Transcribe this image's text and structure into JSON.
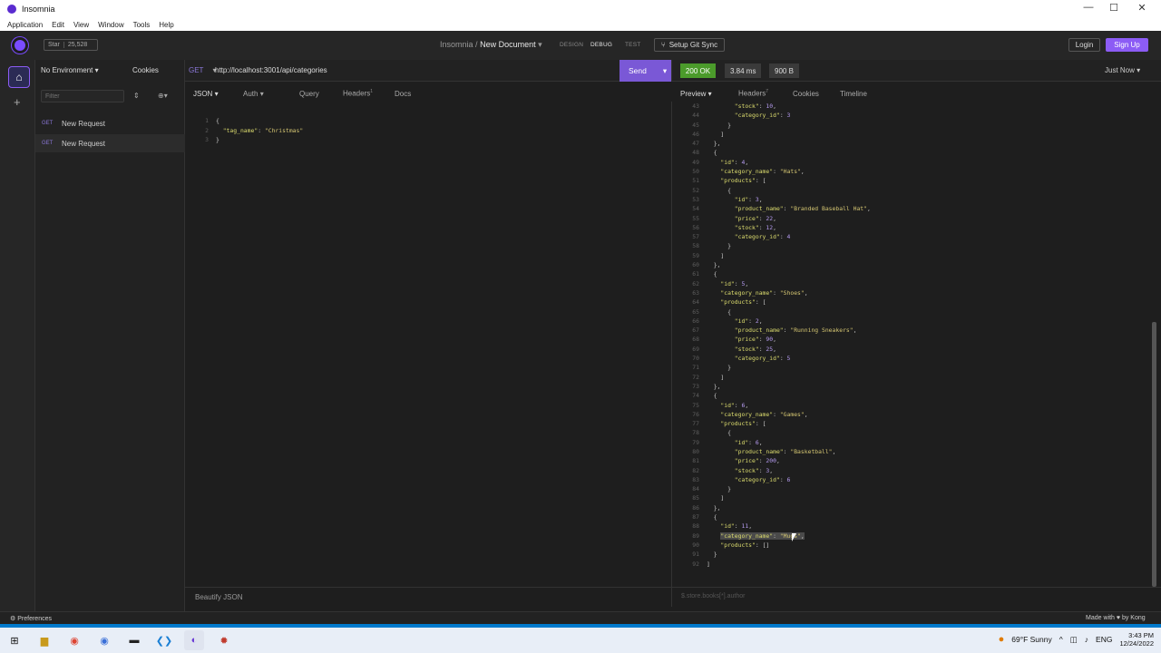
{
  "window": {
    "title": "Insomnia",
    "min": "—",
    "max": "☐",
    "close": "✕"
  },
  "menu": [
    "Application",
    "Edit",
    "View",
    "Window",
    "Tools",
    "Help"
  ],
  "header": {
    "star_label": "Star",
    "star_count": "25,528",
    "workspace": "Insomnia",
    "separator": "/",
    "document": "New Document",
    "modes": [
      "DESIGN",
      "DEBUG",
      "TEST"
    ],
    "git_sync": "Setup Git Sync",
    "login": "Login",
    "signup": "Sign Up"
  },
  "sidebar": {
    "environment": "No Environment",
    "cookies": "Cookies",
    "filter_placeholder": "Filter",
    "requests": [
      {
        "method": "GET",
        "name": "New Request"
      },
      {
        "method": "GET",
        "name": "New Request"
      }
    ]
  },
  "request": {
    "method": "GET",
    "url": "http://localhost:3001/api/categories",
    "send": "Send",
    "tabs": [
      "JSON",
      "Auth",
      "Query",
      "Headers",
      "Docs"
    ],
    "headers_count": "1",
    "body_lines": [
      {
        "n": "1",
        "text": "{"
      },
      {
        "n": "2",
        "key": "\"tag_name\"",
        "val": "\"Christmas\""
      },
      {
        "n": "3",
        "text": "}"
      }
    ],
    "footer": "Beautify JSON"
  },
  "response": {
    "status": "200 OK",
    "time": "3.84 ms",
    "size": "900 B",
    "timestamp": "Just Now",
    "tabs": [
      "Preview",
      "Headers",
      "Cookies",
      "Timeline"
    ],
    "headers_count": "7",
    "filter_placeholder": "$.store.books[*].author",
    "lines": [
      {
        "n": "43",
        "i": 4,
        "k": "\"stock\"",
        "v": "10",
        "t": "num",
        "c": ","
      },
      {
        "n": "44",
        "i": 4,
        "k": "\"category_id\"",
        "v": "3",
        "t": "num",
        "c": ""
      },
      {
        "n": "45",
        "i": 3,
        "p": "}"
      },
      {
        "n": "46",
        "i": 2,
        "p": "]"
      },
      {
        "n": "47",
        "i": 1,
        "p": "},"
      },
      {
        "n": "48",
        "i": 1,
        "p": "{"
      },
      {
        "n": "49",
        "i": 2,
        "k": "\"id\"",
        "v": "4",
        "t": "num",
        "c": ","
      },
      {
        "n": "50",
        "i": 2,
        "k": "\"category_name\"",
        "v": "\"Hats\"",
        "t": "str",
        "c": ","
      },
      {
        "n": "51",
        "i": 2,
        "k": "\"products\"",
        "v": "[",
        "t": "pun",
        "c": ""
      },
      {
        "n": "52",
        "i": 3,
        "p": "{"
      },
      {
        "n": "53",
        "i": 4,
        "k": "\"id\"",
        "v": "3",
        "t": "num",
        "c": ","
      },
      {
        "n": "54",
        "i": 4,
        "k": "\"product_name\"",
        "v": "\"Branded Baseball Hat\"",
        "t": "str",
        "c": ","
      },
      {
        "n": "55",
        "i": 4,
        "k": "\"price\"",
        "v": "22",
        "t": "num",
        "c": ","
      },
      {
        "n": "56",
        "i": 4,
        "k": "\"stock\"",
        "v": "12",
        "t": "num",
        "c": ","
      },
      {
        "n": "57",
        "i": 4,
        "k": "\"category_id\"",
        "v": "4",
        "t": "num",
        "c": ""
      },
      {
        "n": "58",
        "i": 3,
        "p": "}"
      },
      {
        "n": "59",
        "i": 2,
        "p": "]"
      },
      {
        "n": "60",
        "i": 1,
        "p": "},"
      },
      {
        "n": "61",
        "i": 1,
        "p": "{"
      },
      {
        "n": "62",
        "i": 2,
        "k": "\"id\"",
        "v": "5",
        "t": "num",
        "c": ","
      },
      {
        "n": "63",
        "i": 2,
        "k": "\"category_name\"",
        "v": "\"Shoes\"",
        "t": "str",
        "c": ","
      },
      {
        "n": "64",
        "i": 2,
        "k": "\"products\"",
        "v": "[",
        "t": "pun",
        "c": ""
      },
      {
        "n": "65",
        "i": 3,
        "p": "{"
      },
      {
        "n": "66",
        "i": 4,
        "k": "\"id\"",
        "v": "2",
        "t": "num",
        "c": ","
      },
      {
        "n": "67",
        "i": 4,
        "k": "\"product_name\"",
        "v": "\"Running Sneakers\"",
        "t": "str",
        "c": ","
      },
      {
        "n": "68",
        "i": 4,
        "k": "\"price\"",
        "v": "90",
        "t": "num",
        "c": ","
      },
      {
        "n": "69",
        "i": 4,
        "k": "\"stock\"",
        "v": "25",
        "t": "num",
        "c": ","
      },
      {
        "n": "70",
        "i": 4,
        "k": "\"category_id\"",
        "v": "5",
        "t": "num",
        "c": ""
      },
      {
        "n": "71",
        "i": 3,
        "p": "}"
      },
      {
        "n": "72",
        "i": 2,
        "p": "]"
      },
      {
        "n": "73",
        "i": 1,
        "p": "},"
      },
      {
        "n": "74",
        "i": 1,
        "p": "{"
      },
      {
        "n": "75",
        "i": 2,
        "k": "\"id\"",
        "v": "6",
        "t": "num",
        "c": ","
      },
      {
        "n": "76",
        "i": 2,
        "k": "\"category_name\"",
        "v": "\"Games\"",
        "t": "str",
        "c": ","
      },
      {
        "n": "77",
        "i": 2,
        "k": "\"products\"",
        "v": "[",
        "t": "pun",
        "c": ""
      },
      {
        "n": "78",
        "i": 3,
        "p": "{"
      },
      {
        "n": "79",
        "i": 4,
        "k": "\"id\"",
        "v": "6",
        "t": "num",
        "c": ","
      },
      {
        "n": "80",
        "i": 4,
        "k": "\"product_name\"",
        "v": "\"Basketball\"",
        "t": "str",
        "c": ","
      },
      {
        "n": "81",
        "i": 4,
        "k": "\"price\"",
        "v": "200",
        "t": "num",
        "c": ","
      },
      {
        "n": "82",
        "i": 4,
        "k": "\"stock\"",
        "v": "3",
        "t": "num",
        "c": ","
      },
      {
        "n": "83",
        "i": 4,
        "k": "\"category_id\"",
        "v": "6",
        "t": "num",
        "c": ""
      },
      {
        "n": "84",
        "i": 3,
        "p": "}"
      },
      {
        "n": "85",
        "i": 2,
        "p": "]"
      },
      {
        "n": "86",
        "i": 1,
        "p": "},"
      },
      {
        "n": "87",
        "i": 1,
        "p": "{"
      },
      {
        "n": "88",
        "i": 2,
        "k": "\"id\"",
        "v": "11",
        "t": "num",
        "c": ","
      },
      {
        "n": "89",
        "i": 2,
        "k": "\"category_name\"",
        "v": "\"Mugs\"",
        "t": "str",
        "c": ",",
        "hl": true
      },
      {
        "n": "90",
        "i": 2,
        "k": "\"products\"",
        "v": "[]",
        "t": "pun",
        "c": ""
      },
      {
        "n": "91",
        "i": 1,
        "p": "}"
      },
      {
        "n": "92",
        "i": 0,
        "p": "]"
      }
    ]
  },
  "statusbar": {
    "preferences": "Preferences",
    "made_with": "Made with ♥ by Kong"
  },
  "taskbar": {
    "weather": "69°F  Sunny",
    "lang": "ENG",
    "time": "3:43 PM",
    "date": "12/24/2022"
  },
  "colors": {
    "accent": "#8c5cf5",
    "ok": "#4b9b2b",
    "send": "#7a58d6"
  }
}
